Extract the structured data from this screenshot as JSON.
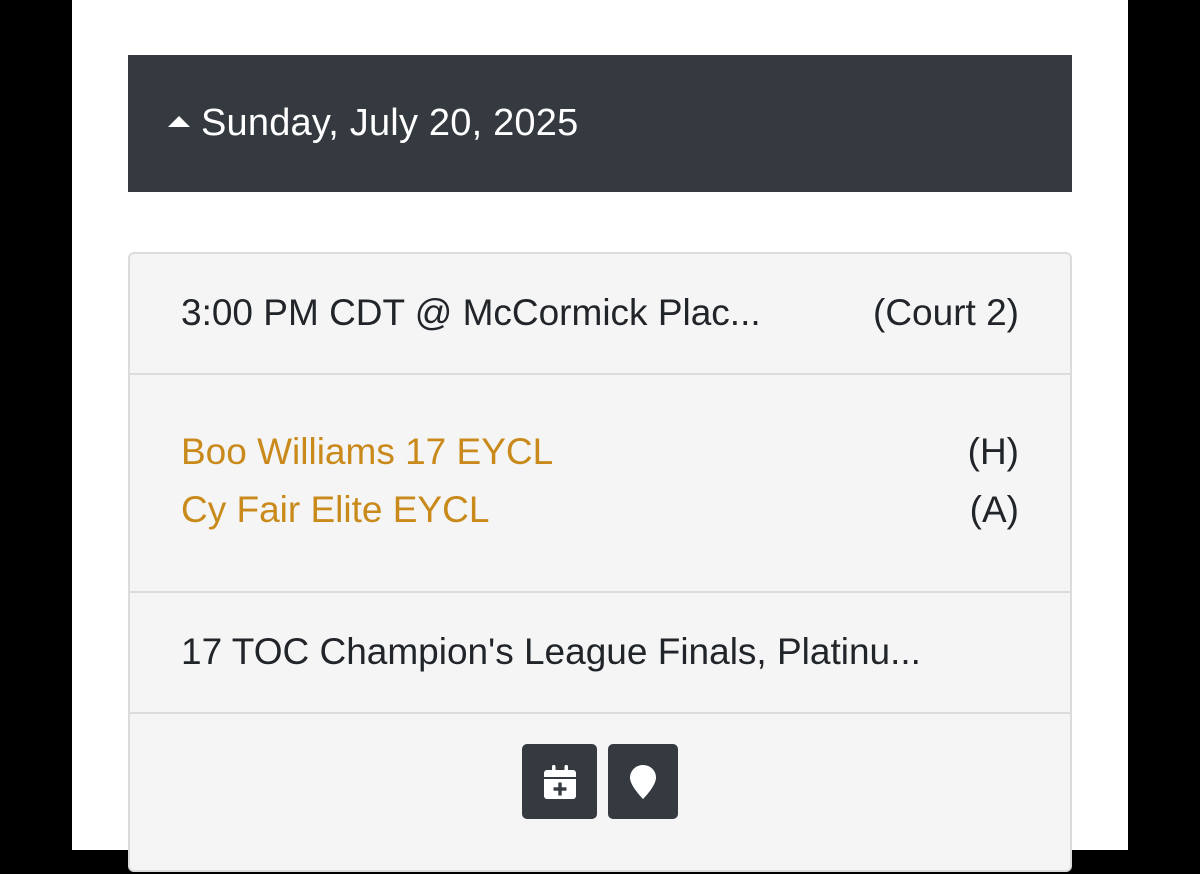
{
  "date_header": {
    "label": "Sunday, July 20, 2025",
    "caret_icon": "caret-up-icon",
    "background": "#343a40"
  },
  "game": {
    "time_venue": "3:00 PM CDT @ McCormick Plac...",
    "court": "(Court 2)",
    "teams": [
      {
        "name": "Boo Williams 17 EYCL",
        "designation": "(H)"
      },
      {
        "name": "Cy Fair Elite EYCL",
        "designation": "(A)"
      }
    ],
    "event": "17 TOC Champion's League Finals, Platinu...",
    "team_color": "#c98a1b"
  },
  "actions": [
    {
      "icon": "calendar-add-icon"
    },
    {
      "icon": "map-pin-icon"
    }
  ]
}
